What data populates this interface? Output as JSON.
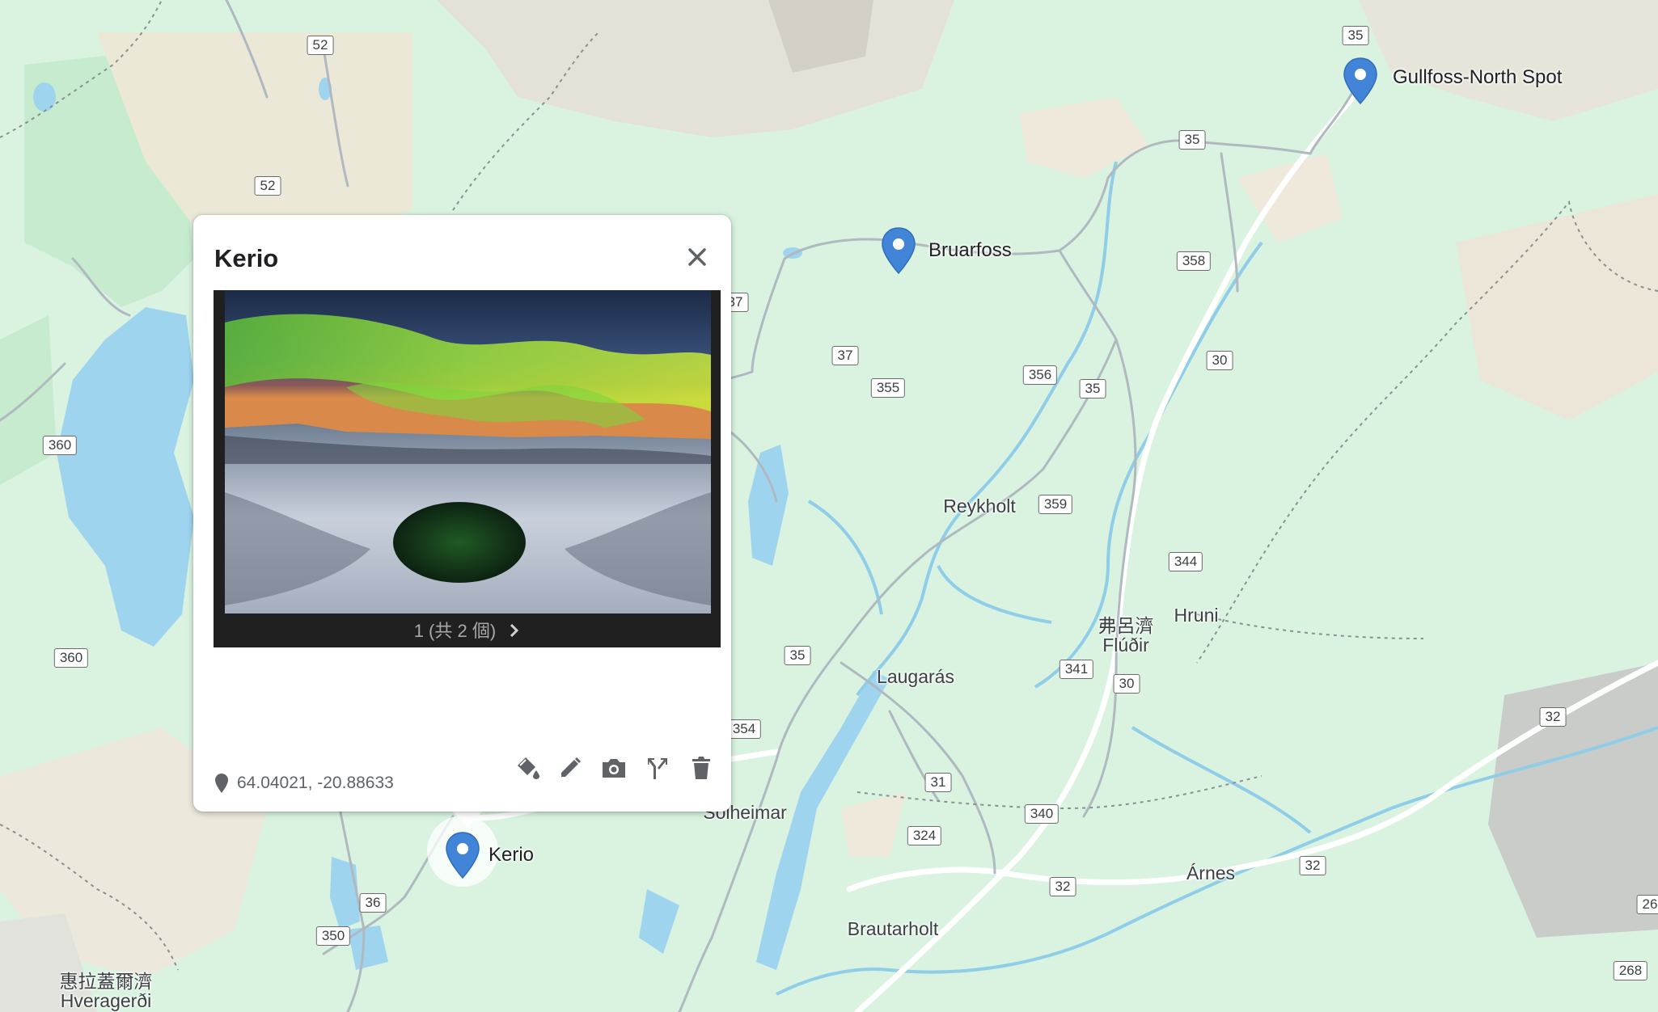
{
  "popup": {
    "title": "Kerio",
    "photo_counter": "1 (共 2 個)",
    "coordinates": "64.04021, -20.88633",
    "close_icon": "close-icon",
    "next_icon": "chevron-right-icon",
    "tools": [
      "paint-bucket-icon",
      "pencil-icon",
      "camera-icon",
      "directions-icon",
      "trash-icon"
    ]
  },
  "markers": [
    {
      "name": "Gullfoss-North Spot"
    },
    {
      "name": "Bruarfoss"
    },
    {
      "name": "Kerio"
    }
  ],
  "towns": [
    "Reykholt",
    "Hruni",
    "弗呂濟",
    "Flúðir",
    "Laugarás",
    "Sólheimar",
    "Árnes",
    "Brautarholt",
    "惠拉蓋爾濟",
    "Hveragerði"
  ],
  "road_shields": [
    "52",
    "52",
    "35",
    "35",
    "358",
    "37",
    "355",
    "356",
    "35",
    "30",
    "360",
    "359",
    "344",
    "360",
    "341",
    "30",
    "35",
    "354",
    "31",
    "340",
    "324",
    "32",
    "32",
    "32",
    "36",
    "350",
    "268",
    "26",
    "37"
  ],
  "colors": {
    "land": "#d9f3e0",
    "pin": "#4285d8",
    "water": "#9fd4ef"
  }
}
